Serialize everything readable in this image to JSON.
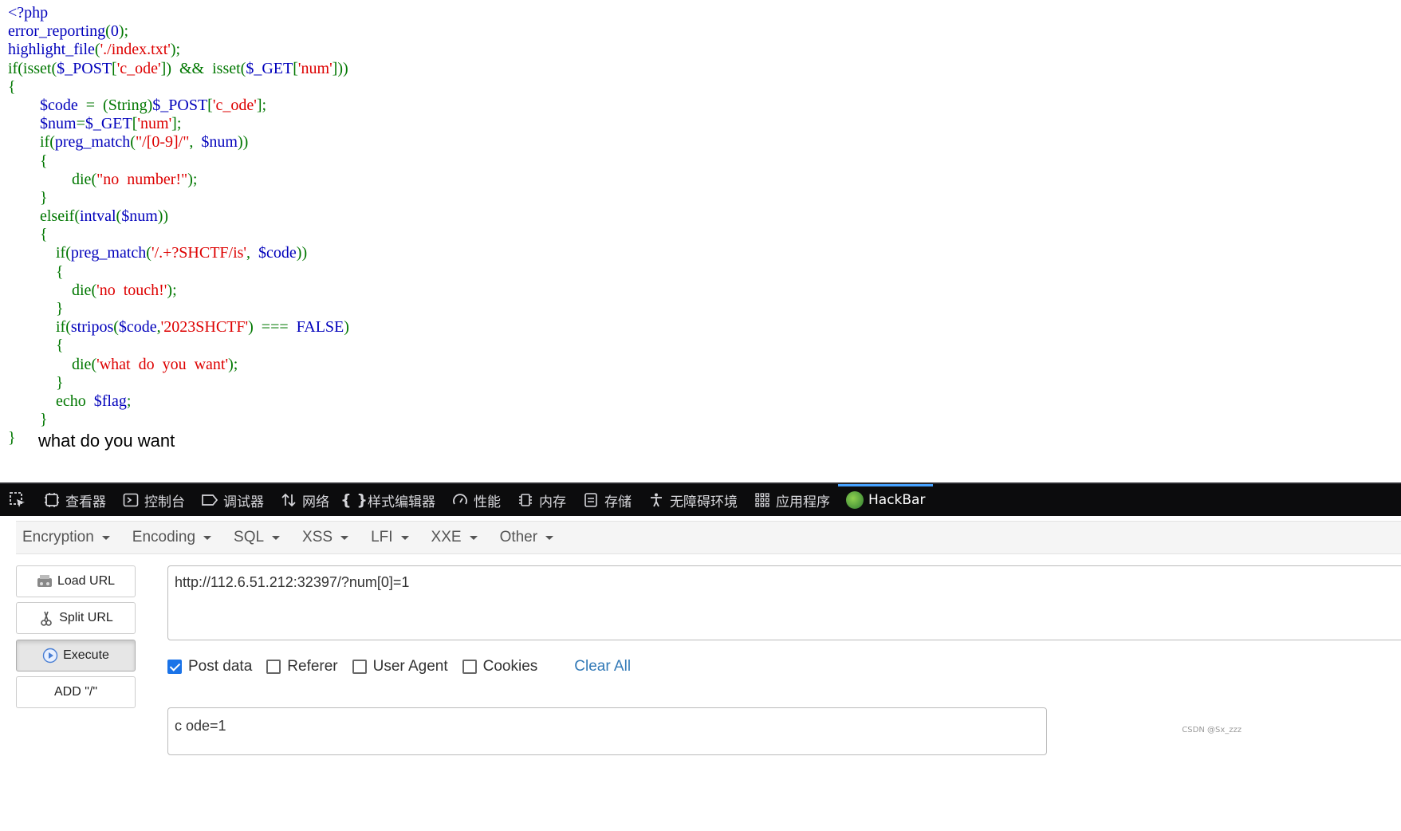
{
  "code": {
    "lines": [
      [
        {
          "t": "<?php",
          "c": "v"
        }
      ],
      [
        {
          "t": "error_reporting",
          "c": "v"
        },
        {
          "t": "(",
          "c": "k"
        },
        {
          "t": "0",
          "c": "v"
        },
        {
          "t": ");",
          "c": "k"
        }
      ],
      [
        {
          "t": "highlight_file",
          "c": "v"
        },
        {
          "t": "(",
          "c": "k"
        },
        {
          "t": "'./index.txt'",
          "c": "s"
        },
        {
          "t": ");",
          "c": "k"
        }
      ],
      [
        {
          "t": "if",
          "c": "k"
        },
        {
          "t": "(",
          "c": "k"
        },
        {
          "t": "isset",
          "c": "k"
        },
        {
          "t": "(",
          "c": "k"
        },
        {
          "t": "$_POST",
          "c": "v"
        },
        {
          "t": "[",
          "c": "k"
        },
        {
          "t": "'c_ode'",
          "c": "s"
        },
        {
          "t": "])  &&  ",
          "c": "k"
        },
        {
          "t": "isset",
          "c": "k"
        },
        {
          "t": "(",
          "c": "k"
        },
        {
          "t": "$_GET",
          "c": "v"
        },
        {
          "t": "[",
          "c": "k"
        },
        {
          "t": "'num'",
          "c": "s"
        },
        {
          "t": "]))",
          "c": "k"
        }
      ],
      [
        {
          "t": "{",
          "c": "k"
        }
      ],
      [
        {
          "t": "        ",
          "c": "k"
        },
        {
          "t": "$code",
          "c": "v"
        },
        {
          "t": "  =  (String)",
          "c": "k"
        },
        {
          "t": "$_POST",
          "c": "v"
        },
        {
          "t": "[",
          "c": "k"
        },
        {
          "t": "'c_ode'",
          "c": "s"
        },
        {
          "t": "];",
          "c": "k"
        }
      ],
      [
        {
          "t": "        ",
          "c": "k"
        },
        {
          "t": "$num",
          "c": "v"
        },
        {
          "t": "=",
          "c": "k"
        },
        {
          "t": "$_GET",
          "c": "v"
        },
        {
          "t": "[",
          "c": "k"
        },
        {
          "t": "'num'",
          "c": "s"
        },
        {
          "t": "];",
          "c": "k"
        }
      ],
      [
        {
          "t": "        ",
          "c": "k"
        },
        {
          "t": "if",
          "c": "k"
        },
        {
          "t": "(",
          "c": "k"
        },
        {
          "t": "preg_match",
          "c": "v"
        },
        {
          "t": "(",
          "c": "k"
        },
        {
          "t": "\"/[0-9]/\"",
          "c": "s"
        },
        {
          "t": ",  ",
          "c": "k"
        },
        {
          "t": "$num",
          "c": "v"
        },
        {
          "t": "))",
          "c": "k"
        }
      ],
      [
        {
          "t": "        {",
          "c": "k"
        }
      ],
      [
        {
          "t": "                ",
          "c": "k"
        },
        {
          "t": "die",
          "c": "k"
        },
        {
          "t": "(",
          "c": "k"
        },
        {
          "t": "\"no  number!\"",
          "c": "s"
        },
        {
          "t": ");",
          "c": "k"
        }
      ],
      [
        {
          "t": "        }",
          "c": "k"
        }
      ],
      [
        {
          "t": "        ",
          "c": "k"
        },
        {
          "t": "elseif",
          "c": "k"
        },
        {
          "t": "(",
          "c": "k"
        },
        {
          "t": "intval",
          "c": "v"
        },
        {
          "t": "(",
          "c": "k"
        },
        {
          "t": "$num",
          "c": "v"
        },
        {
          "t": "))",
          "c": "k"
        }
      ],
      [
        {
          "t": "        {",
          "c": "k"
        }
      ],
      [
        {
          "t": "            ",
          "c": "k"
        },
        {
          "t": "if",
          "c": "k"
        },
        {
          "t": "(",
          "c": "k"
        },
        {
          "t": "preg_match",
          "c": "v"
        },
        {
          "t": "(",
          "c": "k"
        },
        {
          "t": "'/.+?SHCTF/is'",
          "c": "s"
        },
        {
          "t": ",  ",
          "c": "k"
        },
        {
          "t": "$code",
          "c": "v"
        },
        {
          "t": "))",
          "c": "k"
        }
      ],
      [
        {
          "t": "            {",
          "c": "k"
        }
      ],
      [
        {
          "t": "                ",
          "c": "k"
        },
        {
          "t": "die",
          "c": "k"
        },
        {
          "t": "(",
          "c": "k"
        },
        {
          "t": "'no  touch!'",
          "c": "s"
        },
        {
          "t": ");",
          "c": "k"
        }
      ],
      [
        {
          "t": "            }",
          "c": "k"
        }
      ],
      [
        {
          "t": "            ",
          "c": "k"
        },
        {
          "t": "if",
          "c": "k"
        },
        {
          "t": "(",
          "c": "k"
        },
        {
          "t": "stripos",
          "c": "v"
        },
        {
          "t": "(",
          "c": "k"
        },
        {
          "t": "$code",
          "c": "v"
        },
        {
          "t": ",",
          "c": "k"
        },
        {
          "t": "'2023SHCTF'",
          "c": "s"
        },
        {
          "t": ")  ===  ",
          "c": "k"
        },
        {
          "t": "FALSE",
          "c": "v"
        },
        {
          "t": ")",
          "c": "k"
        }
      ],
      [
        {
          "t": "            {",
          "c": "k"
        }
      ],
      [
        {
          "t": "                ",
          "c": "k"
        },
        {
          "t": "die",
          "c": "k"
        },
        {
          "t": "(",
          "c": "k"
        },
        {
          "t": "'what  do  you  want'",
          "c": "s"
        },
        {
          "t": ");",
          "c": "k"
        }
      ],
      [
        {
          "t": "            }",
          "c": "k"
        }
      ],
      [
        {
          "t": "            ",
          "c": "k"
        },
        {
          "t": "echo  ",
          "c": "k"
        },
        {
          "t": "$flag",
          "c": "v"
        },
        {
          "t": ";",
          "c": "k"
        }
      ],
      [
        {
          "t": "        }",
          "c": "k"
        }
      ],
      [
        {
          "t": "}",
          "c": "k"
        }
      ]
    ],
    "output": "what do you want"
  },
  "devtools": {
    "tabs": [
      {
        "name": "inspector",
        "label": "查看器",
        "icon": "inspector-icon"
      },
      {
        "name": "console",
        "label": "控制台",
        "icon": "console-icon"
      },
      {
        "name": "debugger",
        "label": "调试器",
        "icon": "debugger-icon"
      },
      {
        "name": "network",
        "label": "网络",
        "icon": "network-icon"
      },
      {
        "name": "style-editor",
        "label": "样式编辑器",
        "icon": "braces-icon"
      },
      {
        "name": "performance",
        "label": "性能",
        "icon": "gauge-icon"
      },
      {
        "name": "memory",
        "label": "内存",
        "icon": "chip-icon"
      },
      {
        "name": "storage",
        "label": "存储",
        "icon": "storage-icon"
      },
      {
        "name": "accessibility",
        "label": "无障碍环境",
        "icon": "accessibility-icon"
      },
      {
        "name": "application",
        "label": "应用程序",
        "icon": "grid-icon"
      },
      {
        "name": "hackbar",
        "label": "HackBar",
        "icon": "hackbar-icon",
        "active": true
      }
    ]
  },
  "hackbar": {
    "menus": [
      "Encryption",
      "Encoding",
      "SQL",
      "XSS",
      "LFI",
      "XXE",
      "Other"
    ],
    "buttons": {
      "load_url": "Load URL",
      "split_url": "Split URL",
      "execute": "Execute",
      "add_slash": "ADD \"/\""
    },
    "url": "http://112.6.51.212:32397/?num[0]=1",
    "options": {
      "post_data": {
        "label": "Post data",
        "checked": true
      },
      "referer": {
        "label": "Referer",
        "checked": false
      },
      "user_agent": {
        "label": "User Agent",
        "checked": false
      },
      "cookies": {
        "label": "Cookies",
        "checked": false
      }
    },
    "clear_all": "Clear All",
    "post_body": "c ode=1"
  },
  "watermark": "CSDN @Sx_zzz",
  "colors": {
    "php_keyword": "#007700",
    "php_default": "#0000bb",
    "php_string": "#dd0000",
    "devtools_bg": "#0c0c0d",
    "accent": "#45a1ff",
    "link": "#337ab7"
  }
}
